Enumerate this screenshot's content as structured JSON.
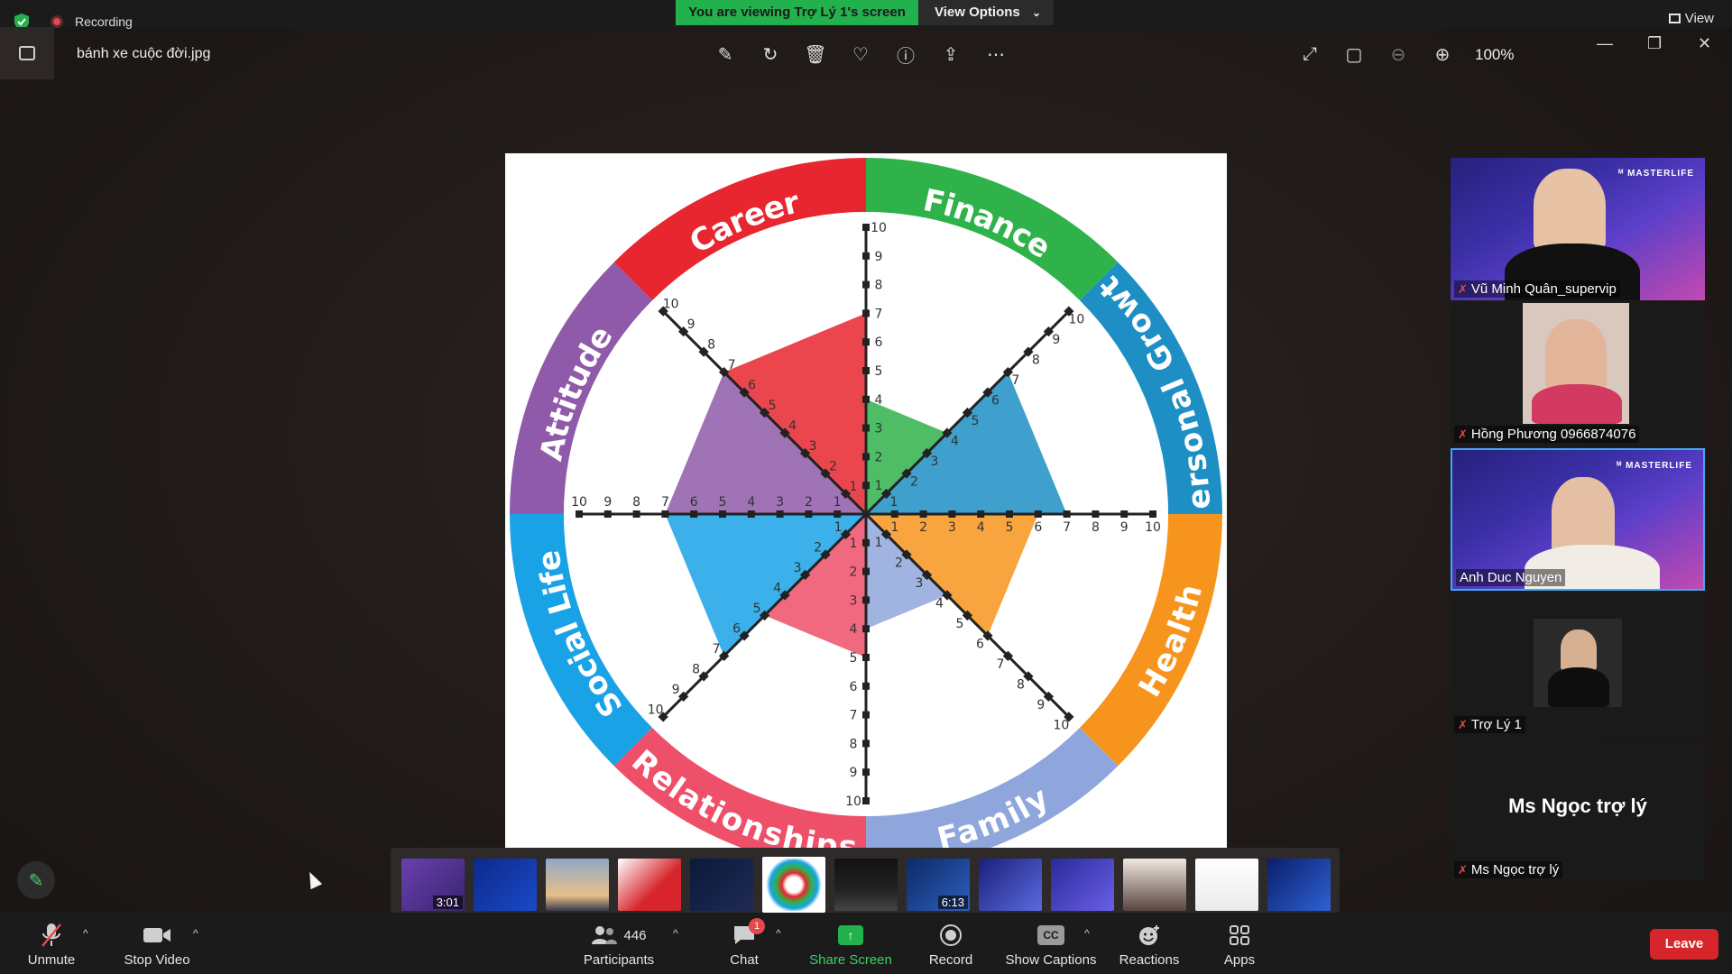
{
  "top": {
    "recording_label": "Recording",
    "viewing_banner": "You are viewing Trợ Lý 1's screen",
    "view_options": "View Options",
    "view_label": "View"
  },
  "viewer": {
    "filename": "bánh xe cuộc đời.jpg",
    "zoom": "100%"
  },
  "wheel": {
    "categories": [
      "Career",
      "Finance",
      "Personal Growth",
      "Health",
      "Family",
      "Relationships",
      "Social Life",
      "Attitude"
    ],
    "colors": [
      "#e8262f",
      "#2fb24a",
      "#1d8fc5",
      "#f7941d",
      "#8fa6dc",
      "#ee4f69",
      "#1aa2e6",
      "#8e5aa9"
    ],
    "scores": [
      7,
      4,
      7,
      6,
      4,
      5,
      7,
      7
    ],
    "scale_labels": [
      "4",
      "5",
      "6",
      "7",
      "8",
      "9",
      "10"
    ],
    "axis_labels": [
      "1",
      "2",
      "3",
      "4",
      "5",
      "6",
      "7",
      "8",
      "9",
      "10"
    ]
  },
  "participants": [
    {
      "name": "Vũ Minh Quân_supervip",
      "muted": true
    },
    {
      "name": "Hồng Phương 0966874076",
      "muted": true
    },
    {
      "name": "Anh Duc Nguyen",
      "muted": false,
      "active": true
    },
    {
      "name": "Trợ Lý 1",
      "muted": true
    },
    {
      "name": "Ms Ngọc trợ lý",
      "muted": true,
      "display": "Ms Ngọc trợ lý"
    }
  ],
  "thumbnails": [
    {
      "dur": "3:01"
    },
    {
      "dur": ""
    },
    {
      "dur": ""
    },
    {
      "dur": ""
    },
    {
      "dur": ""
    },
    {
      "dur": "",
      "selected": true
    },
    {
      "dur": ""
    },
    {
      "dur": "6:13"
    },
    {
      "dur": ""
    },
    {
      "dur": ""
    },
    {
      "dur": ""
    },
    {
      "dur": ""
    },
    {
      "dur": ""
    }
  ],
  "bottombar": {
    "unmute": "Unmute",
    "stop_video": "Stop Video",
    "participants": "Participants",
    "participants_count": "446",
    "chat": "Chat",
    "chat_badge": "1",
    "share": "Share Screen",
    "record": "Record",
    "captions": "Show Captions",
    "reactions": "Reactions",
    "apps": "Apps",
    "leave": "Leave"
  }
}
